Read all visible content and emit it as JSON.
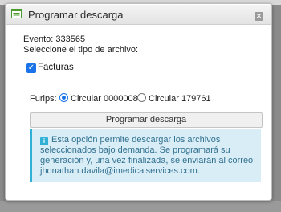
{
  "dialog": {
    "title": "Programar descarga",
    "evento_line": "Evento: 333565",
    "seleccione_label": "Seleccione el tipo de archivo:",
    "facturas_label": "Facturas",
    "furips_label": "Furips:",
    "radio_1_label": "Circular 0000008",
    "radio_2_label": "Circular 179761",
    "submit_label": "Programar descarga",
    "info_text": "Esta opción permite descargar los archivos seleccionados bajo demanda. Se programará su generación y, una vez finalizada, se enviarán al correo jhonathan.davila@imedicalservices.com."
  },
  "colors": {
    "accent": "#1a73e8",
    "info_bg": "#d9edf7",
    "info_text": "#31708f"
  },
  "icons": {
    "title": "document-icon",
    "close": "close-icon",
    "info": "info-icon"
  }
}
